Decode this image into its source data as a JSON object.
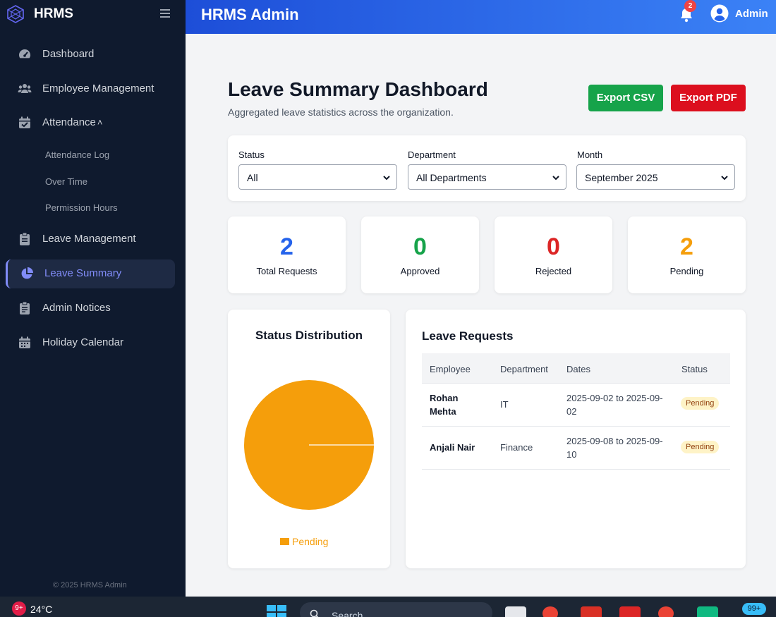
{
  "sidebar": {
    "brand": "HRMS",
    "items": [
      {
        "label": "Dashboard",
        "icon": "gauge-icon"
      },
      {
        "label": "Employee Management",
        "icon": "users-icon"
      },
      {
        "label": "Attendance",
        "icon": "calendar-check-icon"
      },
      {
        "label": "Leave Management",
        "icon": "clipboard-icon"
      },
      {
        "label": "Leave Summary",
        "icon": "pie-chart-icon"
      },
      {
        "label": "Admin Notices",
        "icon": "clipboard-list-icon"
      },
      {
        "label": "Holiday Calendar",
        "icon": "calendar-icon"
      }
    ],
    "sub_items": [
      "Attendance Log",
      "Over Time",
      "Permission Hours"
    ],
    "active": "Leave Summary",
    "copyright": "© 2025 HRMS Admin"
  },
  "header": {
    "title": "HRMS Admin",
    "notification_count": "2",
    "user": "Admin"
  },
  "page": {
    "title": "Leave Summary Dashboard",
    "subtitle": "Aggregated leave statistics across the organization.",
    "export_csv": "Export CSV",
    "export_pdf": "Export PDF"
  },
  "filters": {
    "status": {
      "label": "Status",
      "value": "All"
    },
    "department": {
      "label": "Department",
      "value": "All Departments"
    },
    "month": {
      "label": "Month",
      "value": "September 2025"
    }
  },
  "stats": [
    {
      "value": "2",
      "label": "Total Requests",
      "color": "#2563eb"
    },
    {
      "value": "0",
      "label": "Approved",
      "color": "#16a34a"
    },
    {
      "value": "0",
      "label": "Rejected",
      "color": "#dc2626"
    },
    {
      "value": "2",
      "label": "Pending",
      "color": "#f59e0b"
    }
  ],
  "chart_data": {
    "type": "pie",
    "title": "Status Distribution",
    "categories": [
      "Pending"
    ],
    "values": [
      2
    ],
    "colors": [
      "#f59e0b"
    ],
    "legend": "bottom"
  },
  "requests": {
    "title": "Leave Requests",
    "columns": [
      "Employee",
      "Department",
      "Dates",
      "Status"
    ],
    "rows": [
      {
        "employee": "Rohan Mehta",
        "department": "IT",
        "dates": "2025-09-02 to 2025-09-02",
        "status": "Pending"
      },
      {
        "employee": "Anjali Nair",
        "department": "Finance",
        "dates": "2025-09-08 to 2025-09-10",
        "status": "Pending"
      }
    ]
  },
  "taskbar": {
    "weather_badge": "9+",
    "temperature": "24°C",
    "search_placeholder": "Search",
    "tray_badge": "99+"
  }
}
